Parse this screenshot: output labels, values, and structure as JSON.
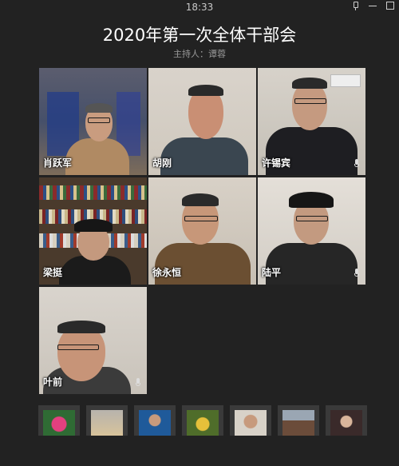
{
  "status_bar": {
    "time": "18:33"
  },
  "window_controls": [
    "pin-icon",
    "minimize-icon",
    "maximize-icon"
  ],
  "meeting": {
    "title": "2020年第一次全体干部会",
    "host_line": "主持人：谭蓉"
  },
  "participants": [
    {
      "name": "肖跃军"
    },
    {
      "name": "胡刚"
    },
    {
      "name": "许锡宾"
    },
    {
      "name": "梁挺"
    },
    {
      "name": "徐永恒"
    },
    {
      "name": "陆平"
    },
    {
      "name": "叶前"
    }
  ],
  "thumbnails": [
    {
      "icon": "lotus-avatar-icon"
    },
    {
      "icon": "sunset-avatar-icon"
    },
    {
      "icon": "person-avatar-icon"
    },
    {
      "icon": "flower-avatar-icon"
    },
    {
      "icon": "person-avatar-icon"
    },
    {
      "icon": "building-avatar-icon"
    },
    {
      "icon": "person-avatar-icon"
    }
  ],
  "colors": {
    "background": "#222222",
    "title": "#ffffff",
    "subtitle": "#9a9a9a"
  }
}
